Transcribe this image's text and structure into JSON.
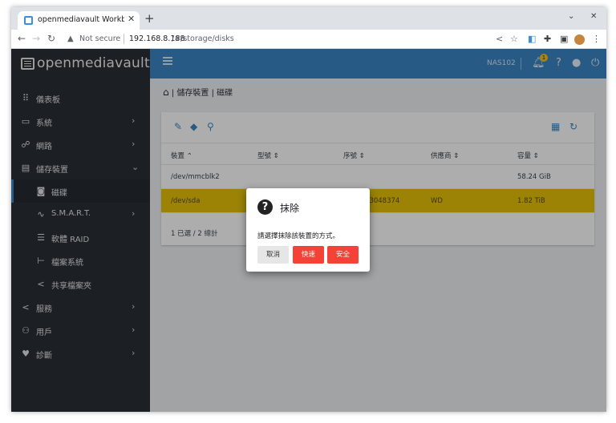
{
  "browser": {
    "tab_title": "openmediavault Workben",
    "new_tab": "+",
    "url_warning": "Not secure",
    "url_host": "192.168.8.188",
    "url_path": "/#/storage/disks"
  },
  "app": {
    "logo": "openmediavault",
    "hostname": "NAS102",
    "notification_count": "1"
  },
  "sidebar": {
    "items": [
      {
        "label": "儀表板",
        "icon": "grid-icon"
      },
      {
        "label": "系統",
        "icon": "laptop-icon"
      },
      {
        "label": "網路",
        "icon": "network-icon"
      },
      {
        "label": "儲存裝置",
        "icon": "storage-icon"
      },
      {
        "label": "磁碟",
        "icon": "disk-icon"
      },
      {
        "label": "S.M.A.R.T.",
        "icon": "pulse-icon"
      },
      {
        "label": "軟體 RAID",
        "icon": "stack-icon"
      },
      {
        "label": "檔案系統",
        "icon": "tree-icon"
      },
      {
        "label": "共享檔案夾",
        "icon": "share-icon"
      },
      {
        "label": "服務",
        "icon": "share-icon"
      },
      {
        "label": "用戶",
        "icon": "users-icon"
      },
      {
        "label": "診斷",
        "icon": "heartbeat-icon"
      }
    ]
  },
  "breadcrumb": {
    "sep": "|",
    "level1": "儲存裝置",
    "level2": "磁碟"
  },
  "table": {
    "columns": [
      "裝置",
      "型號",
      "序號",
      "供應商",
      "容量"
    ],
    "rows": [
      {
        "device": "/dev/mmcblk2",
        "model": "",
        "serial": "",
        "vendor": "",
        "capacity": "58.24 GiB"
      },
      {
        "device": "/dev/sda",
        "model": "",
        "serial": "3241413048374",
        "vendor": "WD",
        "capacity": "1.82 TiB"
      }
    ],
    "footer": "1 已選 / 2 總計"
  },
  "dialog": {
    "title": "抹除",
    "message": "請選擇抹除該裝置的方式。",
    "cancel": "取消",
    "quick": "快速",
    "secure": "安全"
  }
}
